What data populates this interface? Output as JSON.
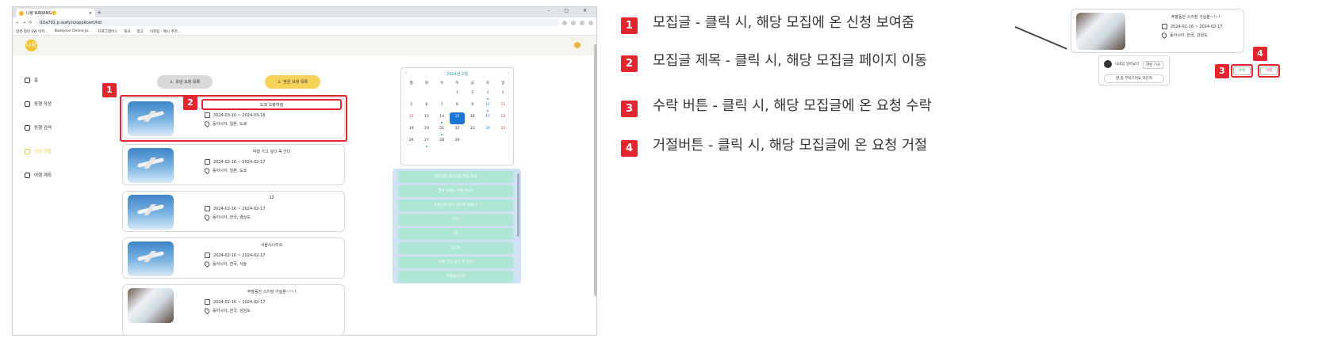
{
  "browser": {
    "tab_title": "나랑 NARANG🙂",
    "window_controls": "–  ▢  ✕",
    "url": "i10a701.p.ssafy.io/applicant/list",
    "bookmarks": [
      "삼성 청년 SW 아카...",
      "Baekjoon Online Ju...",
      "프로그래머스",
      "회사",
      "참고",
      "이로팁 - 예시 추천..."
    ]
  },
  "app": {
    "logo": "나랑",
    "nav": [
      {
        "label": "홈",
        "icon": "home-icon",
        "active": false
      },
      {
        "label": "동행 작성",
        "icon": "edit-icon",
        "active": false
      },
      {
        "label": "동행 검색",
        "icon": "search-icon",
        "active": false
      },
      {
        "label": "신청 현황",
        "icon": "users-icon",
        "active": true
      },
      {
        "label": "여행 계획",
        "icon": "calendar-icon",
        "active": false
      }
    ],
    "filters": {
      "sent": "보낸 요청 목록",
      "received": "받은 요청 목록"
    },
    "cards": [
      {
        "title": "도쿄 오랑여행",
        "dates": "2024-03-10 ~ 2024-03-16",
        "location": "동아시아, 일본, 도쿄",
        "thumb": "plane"
      },
      {
        "title": "여행 가고 싶다 꼭 간다",
        "dates": "2024-02-16 ~ 2024-02-17",
        "location": "동아시아, 일본, 도쿄",
        "thumb": "plane"
      },
      {
        "title": "12",
        "dates": "2024-02-16 ~ 2024-02-17",
        "location": "동아시아, 한국, 경상도",
        "thumb": "plane"
      },
      {
        "title": "서울시나리오",
        "dates": "2024-02-16 ~ 2024-02-17",
        "location": "동아시아, 한국, 서울",
        "thumb": "plane"
      },
      {
        "title": "주말동안 스키장 가실분~!~!",
        "dates": "2024-02-16 ~ 2024-02-17",
        "location": "동아시아, 한국, 강원도",
        "thumb": "snow"
      }
    ],
    "calendar": {
      "title": "2024년 2월",
      "weekdays": [
        "월",
        "화",
        "수",
        "목",
        "금",
        "토",
        "일"
      ],
      "rows": [
        [
          "",
          "",
          "",
          "1",
          "2",
          "3",
          "4"
        ],
        [
          "5",
          "6",
          "7",
          "8",
          "9",
          "10",
          "11"
        ],
        [
          "12",
          "13",
          "14",
          "15",
          "16",
          "17",
          "18"
        ],
        [
          "19",
          "20",
          "21",
          "22",
          "23",
          "24",
          "25"
        ],
        [
          "26",
          "27",
          "28",
          "29",
          "",
          "",
          ""
        ]
      ],
      "today": "15",
      "dots": [
        "3",
        "10",
        "14",
        "21",
        "27"
      ]
    },
    "plans": [
      "대학생들 졸업여행 전국 여행",
      "발표 보세요 이게 까요?",
      "이번 서나리오 안으로 롤업나",
      "123",
      "12",
      "1234",
      "여행 가고 싶다 꼭 간다",
      "서울시나리오"
    ]
  },
  "legend": [
    {
      "num": "1",
      "text": "모집글 - 클릭 시, 해당 모집에 온 신청 보여줌"
    },
    {
      "num": "2",
      "text": "모집글 제목 - 클릭 시, 해당 모집글 페이지 이동"
    },
    {
      "num": "3",
      "text": "수락 버튼 - 클릭 시, 해당 모집글에 온 요청 수락"
    },
    {
      "num": "4",
      "text": "거절버튼 - 클릭 시, 해당 모집글에 온 요청 거절"
    }
  ],
  "markers": {
    "m1": "1",
    "m2": "2",
    "m3": "3",
    "m4": "4"
  },
  "zoom": {
    "title": "주말동안 스키장 가실분~!~!",
    "dates": "2024-02-16 ~ 2024-02-17",
    "location": "동아시아, 한국, 강원도",
    "requester": "닉네임 넣어요다",
    "profile_link": "관련 기사",
    "message": "잘 좀 부탁드려요 하단자",
    "accept": "수락",
    "reject": "거절"
  },
  "colors": {
    "accent": "#e3262d",
    "filter_active": "#f6d25a",
    "today": "#1b76d3",
    "plan_item": "#aee7d6"
  }
}
